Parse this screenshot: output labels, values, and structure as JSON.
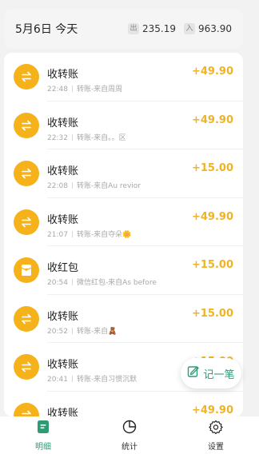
{
  "header": {
    "date": "5月6日 今天",
    "expense_tag": "出",
    "expense": "235.19",
    "income_tag": "入",
    "income": "963.90"
  },
  "transactions": [
    {
      "title": "收转账",
      "time": "22:48",
      "desc": "转账-来自周周",
      "amount": "+49.90",
      "icon": "transfer-icon"
    },
    {
      "title": "收转账",
      "time": "22:32",
      "desc": "转账-来自。。区",
      "amount": "+49.90",
      "icon": "transfer-icon"
    },
    {
      "title": "收转账",
      "time": "22:08",
      "desc": "转账-来自Au revior",
      "amount": "+15.00",
      "icon": "transfer-icon"
    },
    {
      "title": "收转账",
      "time": "21:07",
      "desc": "转账-来自夺朵🌼",
      "amount": "+49.90",
      "icon": "transfer-icon"
    },
    {
      "title": "收红包",
      "time": "20:54",
      "desc": "微信红包-来自As before",
      "amount": "+15.00",
      "icon": "red-packet-icon"
    },
    {
      "title": "收转账",
      "time": "20:52",
      "desc": "转账-来自🧸",
      "amount": "+15.00",
      "icon": "transfer-icon"
    },
    {
      "title": "收转账",
      "time": "20:41",
      "desc": "转账-来自习惯沉默",
      "amount": "+15.00",
      "icon": "transfer-icon"
    },
    {
      "title": "收转账",
      "time": "",
      "desc": "",
      "amount": "+49.90",
      "icon": "transfer-icon"
    }
  ],
  "fab": {
    "label": "记一笔",
    "icon": "edit-note-icon"
  },
  "tabs": [
    {
      "label": "明细",
      "icon": "details-icon",
      "active": true
    },
    {
      "label": "统计",
      "icon": "pie-chart-icon",
      "active": false
    },
    {
      "label": "设置",
      "icon": "gear-icon",
      "active": false
    }
  ],
  "colors": {
    "accent": "#2f9b72",
    "amount": "#f0b323",
    "icon_bg": "#f5b21a"
  }
}
